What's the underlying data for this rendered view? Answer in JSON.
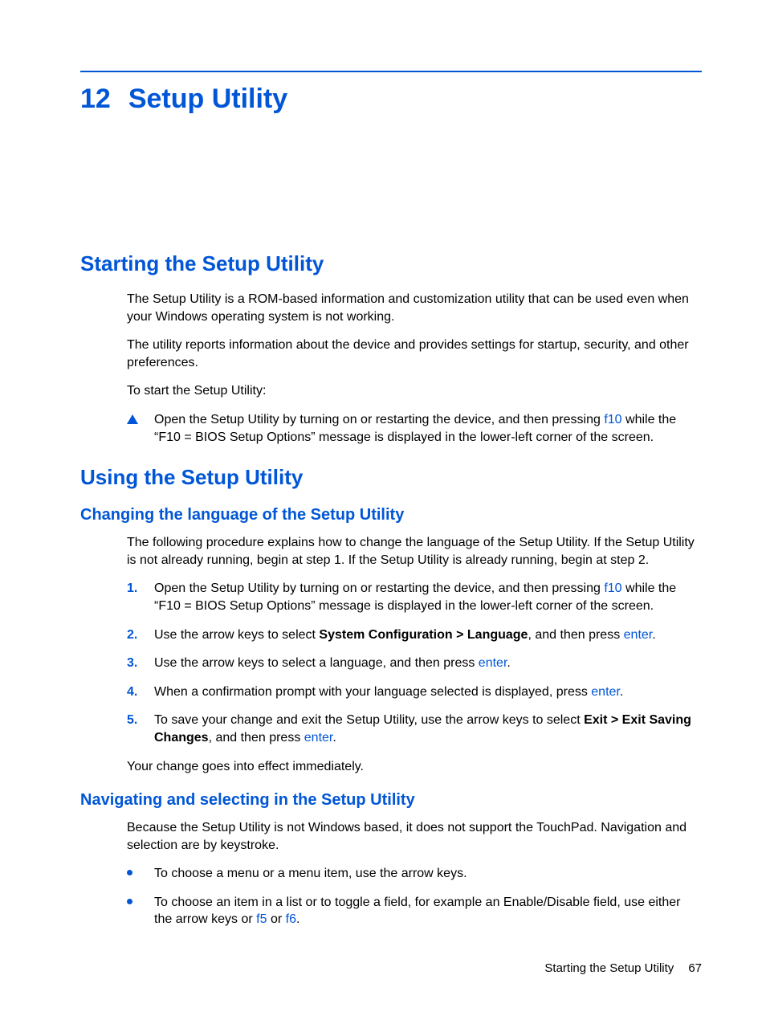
{
  "chapter": {
    "number": "12",
    "title": "Setup Utility"
  },
  "sections": {
    "starting": {
      "heading": "Starting the Setup Utility",
      "p1": "The Setup Utility is a ROM-based information and customization utility that can be used even when your Windows operating system is not working.",
      "p2": "The utility reports information about the device and provides settings for startup, security, and other preferences.",
      "p3": "To start the Setup Utility:",
      "step_a": "Open the Setup Utility by turning on or restarting the device, and then pressing ",
      "step_key": "f10",
      "step_b": " while the “F10 = BIOS Setup Options” message is displayed in the lower-left corner of the screen."
    },
    "using": {
      "heading": "Using the Setup Utility",
      "lang": {
        "heading": "Changing the language of the Setup Utility",
        "intro": "The following procedure explains how to change the language of the Setup Utility. If the Setup Utility is not already running, begin at step 1. If the Setup Utility is already running, begin at step 2.",
        "steps": {
          "s1": {
            "num": "1.",
            "a": "Open the Setup Utility by turning on or restarting the device, and then pressing ",
            "key": "f10",
            "b": " while the “F10 = BIOS Setup Options” message is displayed in the lower-left corner of the screen."
          },
          "s2": {
            "num": "2.",
            "a": "Use the arrow keys to select ",
            "bold": "System Configuration > Language",
            "b": ", and then press ",
            "key": "enter",
            "c": "."
          },
          "s3": {
            "num": "3.",
            "a": "Use the arrow keys to select a language, and then press ",
            "key": "enter",
            "b": "."
          },
          "s4": {
            "num": "4.",
            "a": "When a confirmation prompt with your language selected is displayed, press ",
            "key": "enter",
            "b": "."
          },
          "s5": {
            "num": "5.",
            "a": "To save your change and exit the Setup Utility, use the arrow keys to select ",
            "bold": "Exit > Exit Saving Changes",
            "b": ", and then press ",
            "key": "enter",
            "c": "."
          }
        },
        "outro": "Your change goes into effect immediately."
      },
      "nav": {
        "heading": "Navigating and selecting in the Setup Utility",
        "intro": "Because the Setup Utility is not Windows based, it does not support the TouchPad. Navigation and selection are by keystroke.",
        "b1": "To choose a menu or a menu item, use the arrow keys.",
        "b2": {
          "a": "To choose an item in a list or to toggle a field, for example an Enable/Disable field, use either the arrow keys or ",
          "k1": "f5",
          "mid": " or ",
          "k2": "f6",
          "end": "."
        }
      }
    }
  },
  "footer": {
    "label": "Starting the Setup Utility",
    "page": "67"
  }
}
